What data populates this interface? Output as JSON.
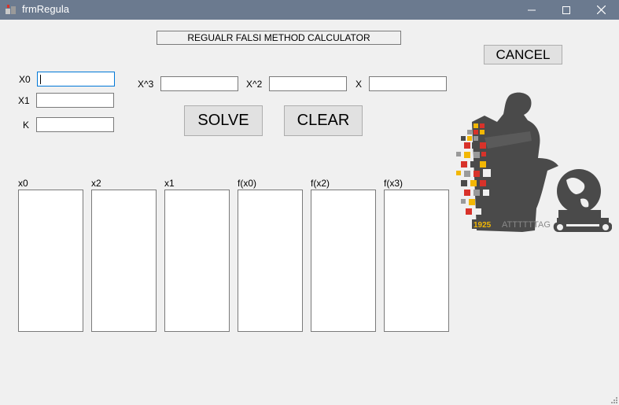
{
  "window": {
    "title": "frmRegula",
    "minimize_glyph": "—",
    "maximize_glyph": "☐",
    "close_glyph": "✕"
  },
  "heading": "REGUALR FALSI METHOD CALCULATOR",
  "inputs": {
    "x0_label": "X0",
    "x1_label": "X1",
    "k_label": "K",
    "x3_coef_label": "X^3",
    "x2_coef_label": "X^2",
    "x_coef_label": "X",
    "x0_value": "",
    "x1_value": "",
    "k_value": "",
    "x3_coef_value": "",
    "x2_coef_value": "",
    "x_coef_value": ""
  },
  "buttons": {
    "solve": "SOLVE",
    "clear": "CLEAR",
    "cancel": "CANCEL"
  },
  "columns": [
    "x0",
    "x2",
    "x1",
    "f(x0)",
    "f(x2)",
    "f(x3)"
  ],
  "logo": {
    "year_text": "1925",
    "dna_text": "ATTTTTTAG"
  },
  "colors": {
    "titlebar": "#6b7a8f",
    "background": "#f0f0f0",
    "logo_gray": "#4a4a4a",
    "logo_red": "#d8322a",
    "logo_yellow": "#f2b705"
  }
}
